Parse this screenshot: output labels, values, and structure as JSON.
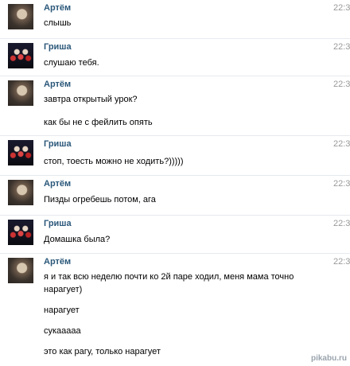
{
  "messages": [
    {
      "author": "Артём",
      "avatar": "artem",
      "time": "22:3",
      "lines": [
        "слышь"
      ]
    },
    {
      "author": "Гриша",
      "avatar": "grisha",
      "time": "22:3",
      "lines": [
        "слушаю тебя."
      ]
    },
    {
      "author": "Артём",
      "avatar": "artem",
      "time": "22:3",
      "lines": [
        "завтра открытый урок?",
        "как бы не с фейлить опять"
      ]
    },
    {
      "author": "Гриша",
      "avatar": "grisha",
      "time": "22:3",
      "lines": [
        "стоп, тоесть можно не ходить?)))))"
      ]
    },
    {
      "author": "Артём",
      "avatar": "artem",
      "time": "22:3",
      "lines": [
        "Пизды огребешь потом, ага"
      ]
    },
    {
      "author": "Гриша",
      "avatar": "grisha",
      "time": "22:3",
      "lines": [
        "Домашка была?"
      ]
    },
    {
      "author": "Артём",
      "avatar": "artem",
      "time": "22:3",
      "lines": [
        "я и так всю неделю почти ко 2й паре ходил, меня мама точно",
        "нарагует)",
        "нарагует",
        "сукааааа",
        "это как рагу, только нарагует"
      ]
    }
  ],
  "watermark": "pikabu.ru"
}
